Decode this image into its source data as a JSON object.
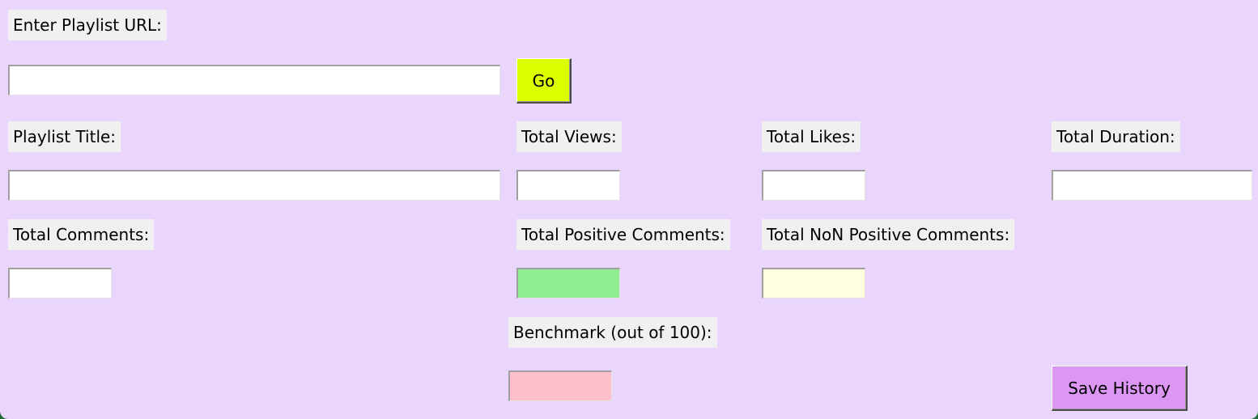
{
  "labels": {
    "url": "Enter Playlist URL:",
    "title": "Playlist Title:",
    "views": "Total Views:",
    "likes": "Total Likes:",
    "duration": "Total Duration:",
    "comments": "Total Comments:",
    "positive": "Total Positive Comments:",
    "non_positive": "Total NoN Positive Comments:",
    "benchmark": "Benchmark (out of 100):"
  },
  "buttons": {
    "go": "Go",
    "save": "Save History"
  },
  "fields": {
    "url": "",
    "title": "",
    "views": "",
    "likes": "",
    "duration": "",
    "comments": "",
    "positive": "",
    "non_positive": "",
    "benchmark": ""
  },
  "colors": {
    "window_bg": "#ead5fc",
    "label_bg": "#f0f0f0",
    "go_button": "#dcff00",
    "save_button": "#dc96f4",
    "positive_field": "#90ee90",
    "non_positive_field": "#ffffe0",
    "benchmark_field": "#ffc0cb"
  }
}
